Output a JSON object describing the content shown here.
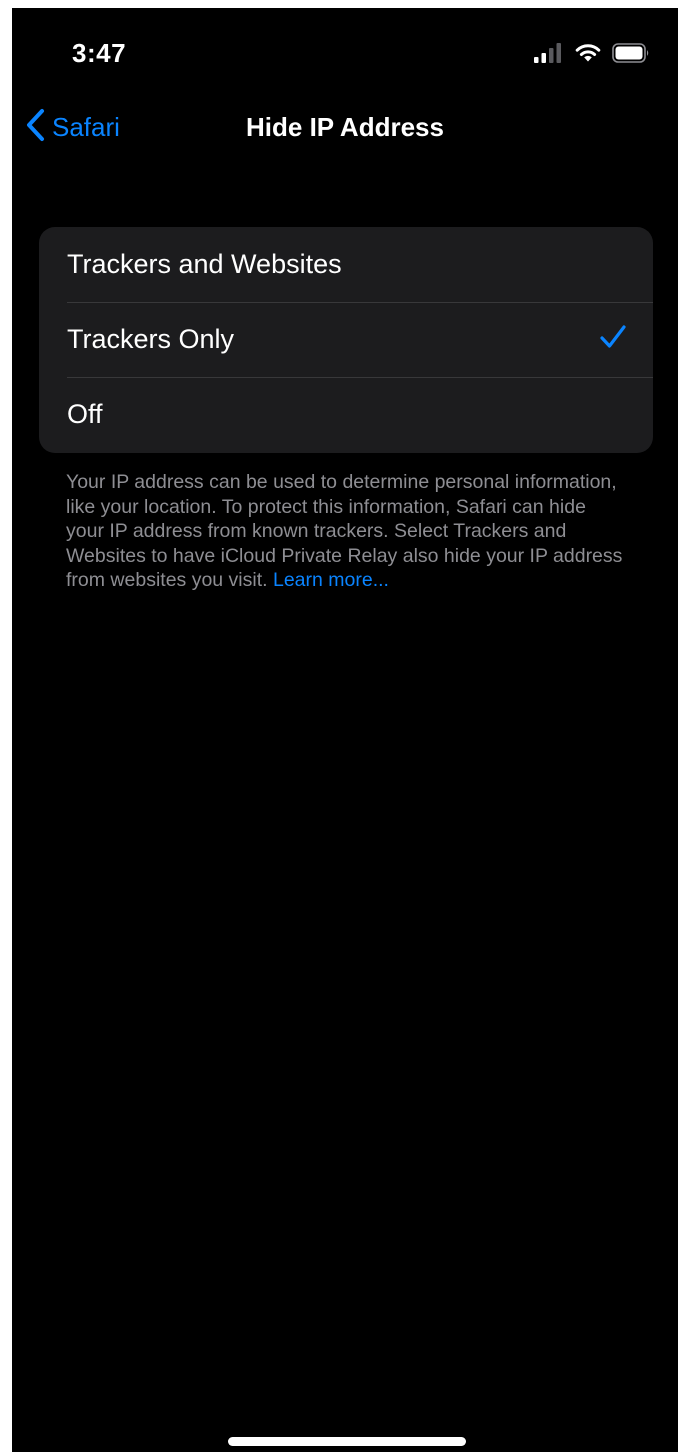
{
  "status_bar": {
    "time": "3:47",
    "icons": [
      "cellular-signal-icon",
      "wifi-icon",
      "battery-icon"
    ]
  },
  "nav": {
    "back_label": "Safari",
    "title": "Hide IP Address"
  },
  "options": [
    {
      "label": "Trackers and Websites",
      "selected": false
    },
    {
      "label": "Trackers Only",
      "selected": true
    },
    {
      "label": "Off",
      "selected": false
    }
  ],
  "footer": {
    "description": "Your IP address can be used to determine personal information, like your location. To protect this information, Safari can hide your IP address from known trackers. Select Trackers and Websites to have iCloud Private Relay also hide your IP address from websites you visit.",
    "link": "Learn more..."
  },
  "colors": {
    "accent": "#0a84ff",
    "background": "#000000",
    "group_background": "#1c1c1e",
    "secondary_text": "#8e8e93"
  }
}
